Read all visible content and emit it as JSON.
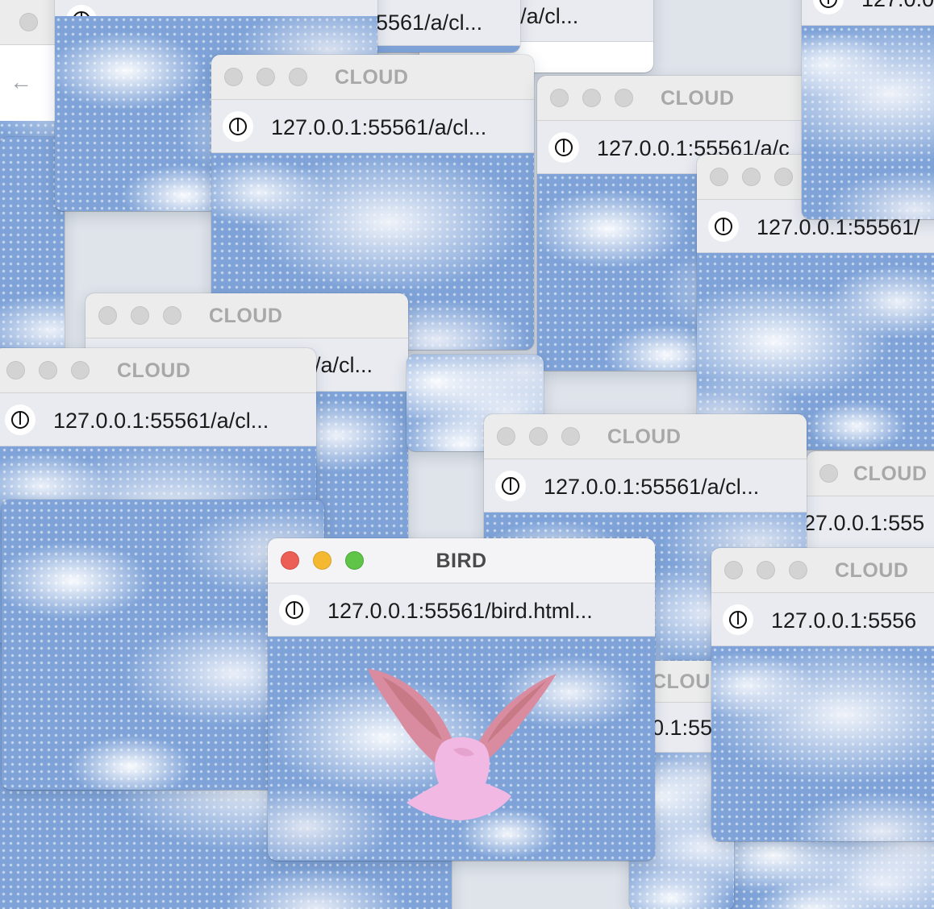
{
  "window_title_cloud": "CLOUD",
  "window_title_bird": "BIRD",
  "url_cloud": "127.0.0.1:55561/a/cl...",
  "url_cloud_clipped_a": "127.0.0.1:55561/a/c",
  "url_cloud_clipped_b": "127.0.0.1:55561/",
  "url_cloud_clipped_c": "127.0.0.1:5556",
  "url_cloud_fragment_a": "5561/a/cl...",
  "url_cloud_fragment_b": "/a/cl...",
  "url_cloud_fragment_c": "27.0.0.1:555",
  "url_cloud_fragment_d": "127.0.0.",
  "url_cloud_fragment_e": "0.1:55",
  "title_cloud_fragment": "CLOU",
  "url_bird": "127.0.0.1:55561/bird.html...",
  "icons": {
    "info": "info-circle-icon",
    "back": "back-arrow-icon"
  },
  "colors": {
    "sky_blue": "#7fa3d8",
    "bird_pink": "#f2b8e4",
    "bird_wing": "#d98ca0",
    "close": "#ec5f57",
    "minimize": "#f4b930",
    "zoom": "#5fc549"
  }
}
